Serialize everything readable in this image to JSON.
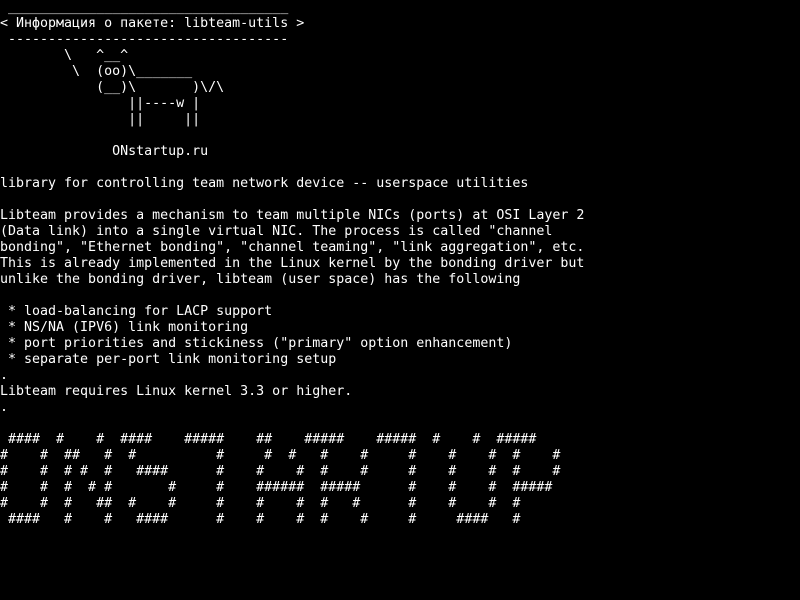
{
  "colors": {
    "background": "#000000",
    "foreground": "#ffffff"
  },
  "header": {
    "top_rule": " ___________________________________",
    "title_line": "< Информация о пакете: libteam-utils >",
    "bottom_rule": " -----------------------------------"
  },
  "cow_art": [
    "        \\   ^__^",
    "         \\  (oo)\\_______",
    "            (__)\\       )\\/\\",
    "                ||----w |",
    "                ||     ||",
    "",
    "              ONstartup.ru"
  ],
  "summary": "library for controlling team network device -- userspace utilities",
  "description": [
    "Libteam provides a mechanism to team multiple NICs (ports) at OSI Layer 2",
    "(Data link) into a single virtual NIC. The process is called \"channel",
    "bonding\", \"Ethernet bonding\", \"channel teaming\", \"link aggregation\", etc.",
    "This is already implemented in the Linux kernel by the bonding driver but",
    "unlike the bonding driver, libteam (user space) has the following"
  ],
  "features": [
    " * load-balancing for LACP support",
    " * NS/NA (IPV6) link monitoring",
    " * port priorities and stickiness (\"primary\" option enhancement)",
    " * separate per-port link monitoring setup"
  ],
  "dot_1": ".",
  "requirement": "Libteam requires Linux kernel 3.3 or higher.",
  "dot_2": ".",
  "banner": [
    " ####  #    #  ####    #####    ##    #####    #####  #    #  #####",
    "#    #  ##   #  #          #     #  #   #    #     #    #    #  #    #",
    "#    #  # #  #   ####      #    #    #  #    #     #    #    #  #    #",
    "#    #  #  # #       #     #    ######  #####      #    #    #  #####",
    "#    #  #   ##  #    #     #    #    #  #   #      #    #    #  #",
    " ####   #    #   ####      #    #    #  #    #     #     ####   #"
  ]
}
